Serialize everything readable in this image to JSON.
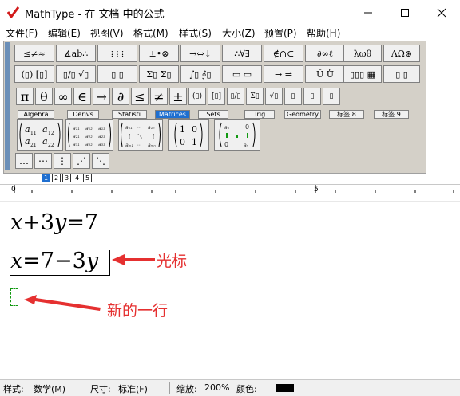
{
  "window": {
    "title": "MathType - 在 文档 中的公式",
    "logo_icon": "mathtype-logo-icon",
    "controls": [
      "minimize-icon",
      "maximize-icon",
      "close-icon"
    ]
  },
  "menu": [
    "文件(F)",
    "编辑(E)",
    "视图(V)",
    "格式(M)",
    "样式(S)",
    "大小(Z)",
    "预置(P)",
    "帮助(H)"
  ],
  "toolbar": {
    "row1": [
      "≤≠≈",
      "∡ab∴",
      "⁞ ⁞ ⁞",
      "±•⊗",
      "→⇔↓",
      "∴∀∃",
      "∉∩⊂",
      "∂∞ℓ",
      "λωθ",
      "ΛΩ⊛"
    ],
    "row2": [
      "(▯) [▯]",
      "▯/▯ √▯",
      "▯ ▯",
      "Σ▯ Σ▯",
      "∫▯ ∮▯",
      "▭ ▭",
      "→ ⇌",
      "Ū Ů",
      "▯▯▯ ▦",
      "▯ ▯"
    ],
    "row3": [
      "π",
      "θ",
      "∞",
      "∈",
      "→",
      "∂",
      "≤",
      "≠",
      "±",
      "(▯)",
      "[▯]",
      "▯/▯",
      "Σ▯",
      "√▯",
      "▯",
      "▯",
      "▯"
    ],
    "tabs": [
      "Algebra",
      "Derivs",
      "Statisti",
      "Matrices",
      "Sets",
      "Trig",
      "Geometry",
      "标签 8",
      "标签 9"
    ],
    "active_tab": "Matrices",
    "matrix_2x2_sub": [
      "a11",
      "a12",
      "a21",
      "a22"
    ],
    "identity_matrix": [
      "1",
      "0",
      "0",
      "1"
    ],
    "row5": [
      "…",
      "⋯",
      "⋮",
      "⋰",
      "⋱"
    ],
    "size_buttons": [
      "1",
      "2",
      "3",
      "4",
      "5"
    ]
  },
  "ruler": {
    "marks": [
      "0",
      "5"
    ]
  },
  "document": {
    "line1": {
      "a": "x",
      "b": "+3",
      "c": "y",
      "d": "=7"
    },
    "line2": {
      "a": "x",
      "b": "=7−3",
      "c": "y"
    },
    "annotation_cursor": "光标",
    "annotation_newline": "新的一行"
  },
  "status": {
    "style_label": "样式:",
    "style_value": "数学(M)",
    "size_label": "尺寸:",
    "size_value": "标准(F)",
    "zoom_label": "缩放:",
    "zoom_value": "200%",
    "color_label": "颜色:",
    "color_value": "#000000"
  }
}
